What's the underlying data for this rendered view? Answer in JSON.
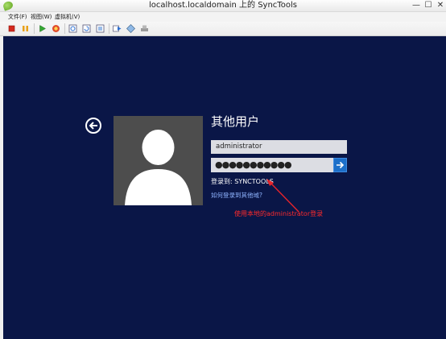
{
  "window": {
    "title": "localhost.localdomain 上的 SyncTools",
    "minimize_glyph": "—",
    "maximize_glyph": "☐",
    "close_glyph": "✕"
  },
  "menu": {
    "file": "文件(F)",
    "view": "视图(W)",
    "vm": "虚拟机(V)"
  },
  "toolbar": {
    "icons": [
      "stop-icon",
      "pause-icon",
      "play-icon",
      "reset-icon",
      "checkpoint-icon",
      "revert-icon",
      "snapshot-icon",
      "share-icon",
      "vmconnect-icon",
      "settings-icon"
    ]
  },
  "login": {
    "heading": "其他用户",
    "username_value": "administrator",
    "password_value": "●●●●●●●●●●●",
    "domain_text": "登录到: SYNCTOOLS",
    "other_domain_link": "如何登录到其他域?",
    "annotation": "使用本地的administrator登录"
  },
  "colors": {
    "console_bg": "#0a1647",
    "submit_button": "#1c6fc9",
    "link": "#8fb4ff",
    "annotation": "#ff2b2b"
  }
}
